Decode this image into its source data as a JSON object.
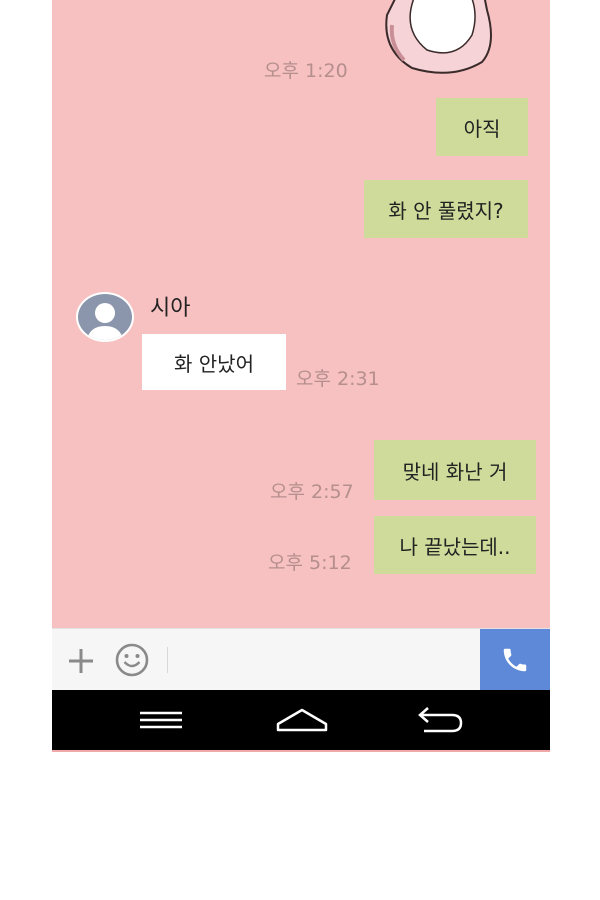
{
  "chat": {
    "messages": [
      {
        "time": "오후 1:20"
      },
      {
        "text": "아직"
      },
      {
        "text": "화 안 풀렸지?"
      },
      {
        "sender": "시아",
        "text": "화 안났어",
        "time": "오후 2:31"
      },
      {
        "text": "맞네 화난 거",
        "time": "오후 2:57"
      },
      {
        "text": "나 끝났는데..",
        "time": "오후 5:12"
      }
    ]
  },
  "input": {
    "icons": [
      "plus-icon",
      "smile-icon",
      "phone-icon"
    ],
    "colors": {
      "call_button": "#5e88d8"
    }
  },
  "navbar": {
    "icons": [
      "menu-icon",
      "home-icon",
      "back-icon"
    ]
  },
  "colors": {
    "chat_background": "#f8c1c1",
    "my_bubble": "#cfdb9a",
    "their_bubble": "#ffffff",
    "timestamp": "#b58e8e"
  }
}
